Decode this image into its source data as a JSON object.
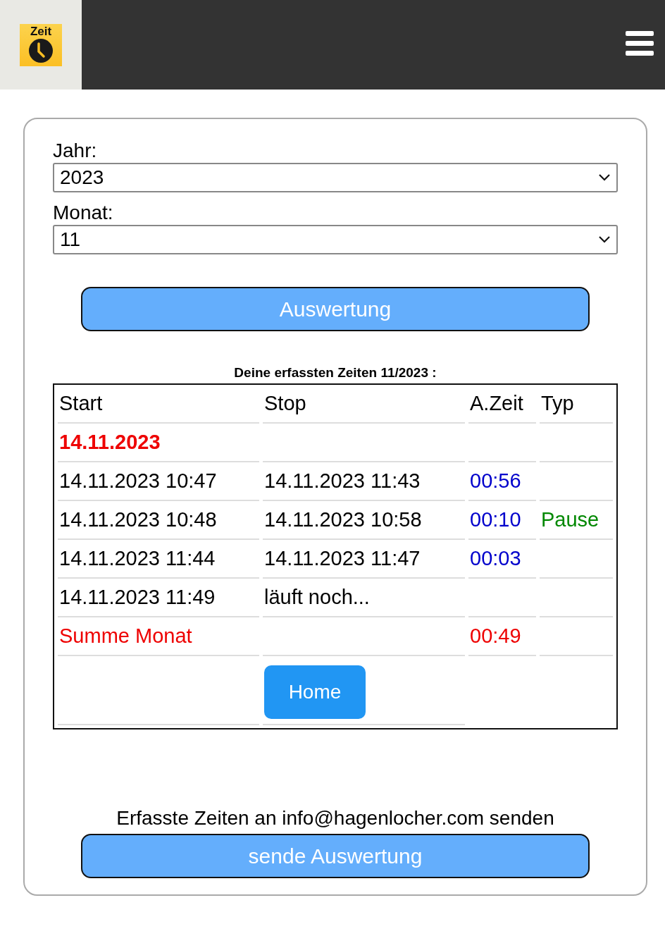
{
  "header": {
    "logo_text": "Zeit"
  },
  "form": {
    "year_label": "Jahr:",
    "year_value": "2023",
    "month_label": "Monat:",
    "month_value": "11",
    "submit": "Auswertung"
  },
  "table": {
    "caption": "Deine erfassten Zeiten 11/2023 :",
    "columns": [
      "Start",
      "Stop",
      "A.Zeit",
      "Typ"
    ],
    "rows": [
      {
        "kind": "date",
        "start": "14.11.2023"
      },
      {
        "kind": "entry",
        "start": "14.11.2023 10:47",
        "stop": "14.11.2023 11:43",
        "duration": "00:56"
      },
      {
        "kind": "entry",
        "start": "14.11.2023 10:48",
        "stop": "14.11.2023 10:58",
        "duration": "00:10",
        "type": "Pause"
      },
      {
        "kind": "entry",
        "start": "14.11.2023 11:44",
        "stop": "14.11.2023 11:47",
        "duration": "00:03"
      },
      {
        "kind": "entry",
        "start": "14.11.2023 11:49",
        "stop": "läuft noch..."
      },
      {
        "kind": "sum",
        "start": "Summe Monat",
        "duration": "00:49"
      }
    ],
    "home_button": "Home"
  },
  "send": {
    "text": "Erfasste Zeiten an info@hagenlocher.com senden",
    "button": "sende Auswertung"
  }
}
